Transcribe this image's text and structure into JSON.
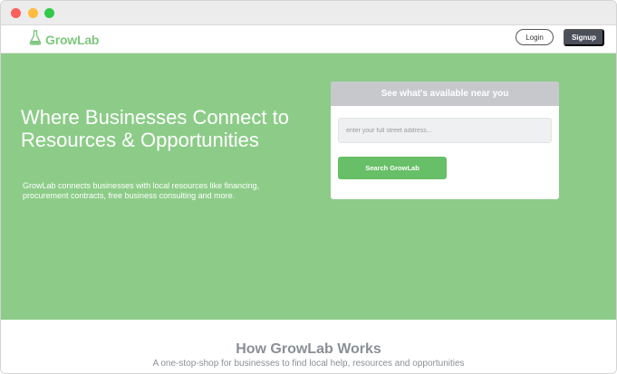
{
  "window": {
    "controls": [
      "close",
      "minimize",
      "maximize"
    ]
  },
  "nav": {
    "logo_text": "GrowLab",
    "logo_icon": "flask-icon",
    "login_label": "Login",
    "signup_label": "Signup"
  },
  "hero": {
    "title": "Where Businesses Connect to Resources & Opportunities",
    "subtitle": "GrowLab connects businesses with local resources like financing, procurement contracts, free business consulting and more."
  },
  "search_card": {
    "header": "See what's available near you",
    "placeholder": "enter your full street address...",
    "button_label": "Search GrowLab"
  },
  "how": {
    "title": "How GrowLab Works",
    "subtitle": "A one-stop-shop for businesses to find local help, resources and opportunities"
  },
  "colors": {
    "brand_green": "#8ccc88",
    "button_green": "#67bf67",
    "signup_dark": "#4a4f5a"
  }
}
